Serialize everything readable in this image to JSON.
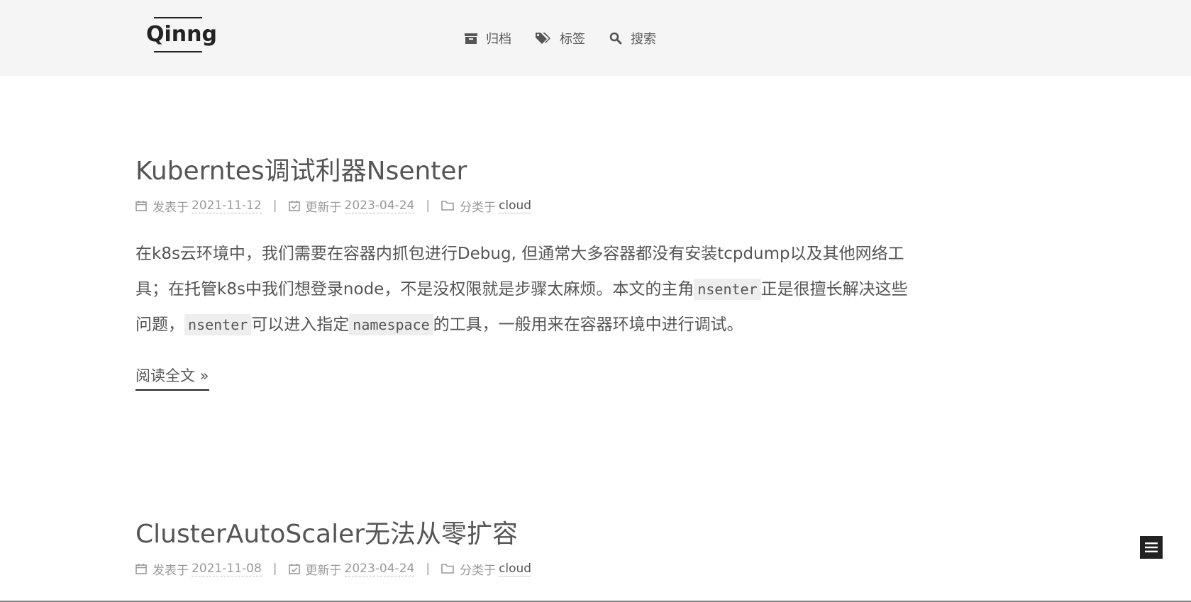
{
  "site": {
    "logo_text": "Qinng"
  },
  "nav": {
    "items": [
      {
        "label": "归档",
        "icon": "archive-icon"
      },
      {
        "label": "标签",
        "icon": "tags-icon"
      },
      {
        "label": "搜索",
        "icon": "search-icon"
      }
    ]
  },
  "posts": [
    {
      "title": "Kuberntes调试利器Nsenter",
      "posted_label": "发表于",
      "posted_date": "2021-11-12",
      "updated_label": "更新于",
      "updated_date": "2023-04-24",
      "category_label": "分类于",
      "category": "cloud",
      "separator": "|",
      "excerpt": {
        "text1": "在k8s云环境中，我们需要在容器内抓包进行Debug, 但通常大多容器都没有安装tcpdump以及其他网络工具；在托管k8s中我们想登录node，不是没权限就是步骤太麻烦。本文的主角",
        "code1": "nsenter",
        "text2": "正是很擅长解决这些问题，",
        "code2": "nsenter",
        "text3": "可以进入指定",
        "code3": "namespace",
        "text4": "的工具，一般用来在容器环境中进行调试。"
      },
      "read_more": "阅读全文 »"
    },
    {
      "title": "ClusterAutoScaler无法从零扩容",
      "posted_label": "发表于",
      "posted_date": "2021-11-08",
      "updated_label": "更新于",
      "updated_date": "2023-04-24",
      "category_label": "分类于",
      "category": "cloud",
      "separator": "|"
    }
  ],
  "colors": {
    "header_bg": "#f5f5f5",
    "text": "#555555",
    "meta": "#999999",
    "logo": "#222222"
  }
}
